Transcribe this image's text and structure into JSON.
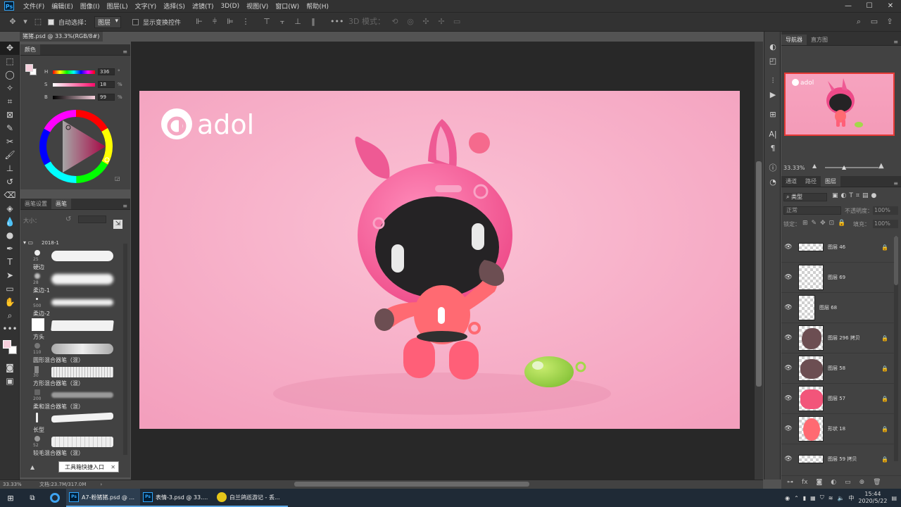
{
  "menubar": {
    "logo": "Ps",
    "items": [
      "文件(F)",
      "编辑(E)",
      "图像(I)",
      "图层(L)",
      "文字(Y)",
      "选择(S)",
      "滤镜(T)",
      "3D(D)",
      "视图(V)",
      "窗口(W)",
      "帮助(H)"
    ],
    "min": "—",
    "max": "☐",
    "close": "✕"
  },
  "options": {
    "auto_select_label": "自动选择：",
    "auto_select_value": "图层",
    "show_transform_label": "显示变换控件",
    "mode3d_label": "3D 模式："
  },
  "document": {
    "tab_title": "猪猪.psd @ 33.3%(RGB/8#)"
  },
  "color_panel": {
    "tab": "颜色",
    "h_label": "H",
    "h_value": "336",
    "h_unit": "°",
    "s_label": "S",
    "s_value": "18",
    "s_unit": "%",
    "b_label": "B",
    "b_value": "99",
    "b_unit": "%"
  },
  "brush_panel": {
    "tabs": [
      "画笔设置",
      "画笔"
    ],
    "size_label": "大小：",
    "folder": "2018-1",
    "brushes": [
      {
        "size": "25",
        "name": "硬边"
      },
      {
        "size": "28",
        "name": "柔边-1"
      },
      {
        "size": "500",
        "name": "柔边-2"
      },
      {
        "size": "",
        "name": "方头"
      },
      {
        "size": "110",
        "name": "圆形混合器笔（混）"
      },
      {
        "size": "30",
        "name": "方形混合器笔（混）"
      },
      {
        "size": "200",
        "name": "柔和混合器笔（混）"
      },
      {
        "size": "",
        "name": "长型"
      },
      {
        "size": "52",
        "name": "较毛混合器笔（混）"
      }
    ],
    "tooltip": "工具箱快捷入口"
  },
  "artwork": {
    "logo_text": "adol",
    "background": "#f7b0c8"
  },
  "status": {
    "zoom": "33.33%",
    "doc_info": "文档:23.7M/317.0M",
    "arrow": "›"
  },
  "navigator": {
    "tabs": [
      "导航器",
      "直方图"
    ],
    "zoom": "33.33%",
    "thumb_logo": "adol"
  },
  "layers_panel": {
    "tabs": [
      "通道",
      "路径",
      "图层"
    ],
    "filter_label": "类型",
    "blend_mode": "正常",
    "opacity_label": "不透明度：",
    "opacity_value": "100%",
    "lock_label": "锁定：",
    "fill_label": "填充：",
    "fill_value": "100%",
    "layers": [
      {
        "name": "图层 46",
        "locked": true
      },
      {
        "name": "图层 69",
        "locked": false
      },
      {
        "name": "图层 68",
        "locked": false
      },
      {
        "name": "图层 296 拷贝",
        "locked": true
      },
      {
        "name": "图层 58",
        "locked": true
      },
      {
        "name": "图层 57",
        "locked": true
      },
      {
        "name": "形状 18",
        "locked": true
      },
      {
        "name": "图层 59 拷贝",
        "locked": true
      }
    ]
  },
  "taskbar": {
    "apps": [
      {
        "label": "A7-粉猪猪.psd @ ...",
        "icon": "Ps"
      },
      {
        "label": "表情-3.psd @ 33....",
        "icon": "Ps"
      },
      {
        "label": "白兰鸽巡游记 - 丢...",
        "icon": "music"
      }
    ],
    "time": "15:44",
    "date": "2020/5/22",
    "ime": "中"
  },
  "colors": {
    "accent": "#31a8ff",
    "pig_pink": "#f45c93",
    "slime_green": "#a3d84a"
  }
}
